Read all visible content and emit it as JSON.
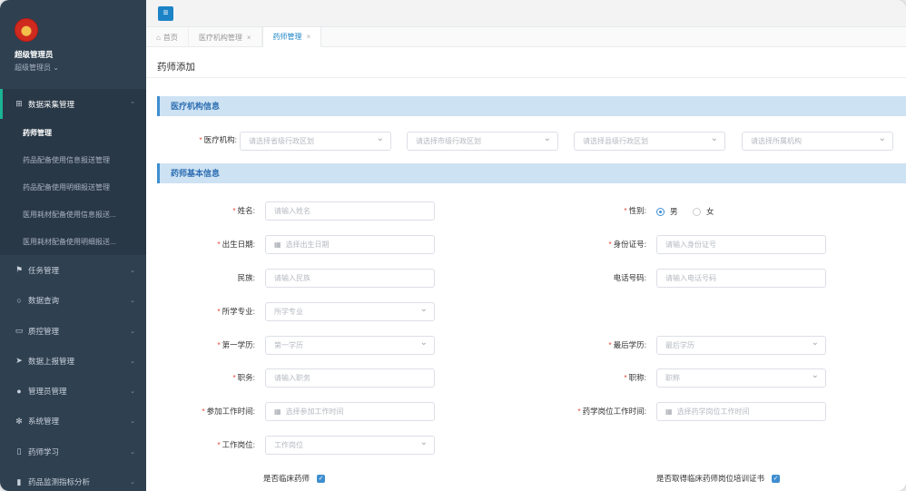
{
  "sidebar": {
    "user_name": "超级管理员",
    "user_role": "超级管理员 ⌄",
    "open_menu": {
      "label": "数据采集管理",
      "icon": "plus-square-icon"
    },
    "sub_items": [
      {
        "label": "药师管理",
        "active": true
      },
      {
        "label": "药品配备使用信息报送管理"
      },
      {
        "label": "药品配备使用明细报送管理"
      },
      {
        "label": "医用耗材配备使用信息报送..."
      },
      {
        "label": "医用耗材配备使用明细报送..."
      }
    ],
    "menu": [
      {
        "label": "任务管理",
        "icon": "flag-icon"
      },
      {
        "label": "数据查询",
        "icon": "search-icon"
      },
      {
        "label": "质控管理",
        "icon": "folder-icon"
      },
      {
        "label": "数据上报管理",
        "icon": "send-icon"
      },
      {
        "label": "管理员管理",
        "icon": "user-icon"
      },
      {
        "label": "系统管理",
        "icon": "gear-icon"
      },
      {
        "label": "药师学习",
        "icon": "book-icon"
      },
      {
        "label": "药品监测指标分析",
        "icon": "bar-chart-icon"
      }
    ]
  },
  "tabs": [
    {
      "label": "首页",
      "home": true
    },
    {
      "label": "医疗机构管理",
      "close": "×"
    },
    {
      "label": "药师管理",
      "close": "×",
      "active": true
    }
  ],
  "page_title": "药师添加",
  "section_org": "医疗机构信息",
  "section_basic": "药师基本信息",
  "org": {
    "label": "医疗机构:",
    "selects": [
      "请选择省级行政区划",
      "请选择市级行政区划",
      "请选择县级行政区划",
      "请选择所属机构"
    ]
  },
  "form": {
    "name_label": "姓名:",
    "name_placeholder": "请输入姓名",
    "gender_label": "性别:",
    "gender_male": "男",
    "gender_female": "女",
    "birth_label": "出生日期:",
    "birth_placeholder": "选择出生日期",
    "id_label": "身份证号:",
    "id_placeholder": "请输入身份证号",
    "ethnic_label": "民族:",
    "ethnic_placeholder": "请输入民族",
    "phone_label": "电话号码:",
    "phone_placeholder": "请输入电话号码",
    "major_label": "所学专业:",
    "major_placeholder": "所学专业",
    "first_edu_label": "第一学历:",
    "first_edu_placeholder": "第一学历",
    "last_edu_label": "最后学历:",
    "last_edu_placeholder": "最后学历",
    "duty_label": "职务:",
    "duty_placeholder": "请输入职务",
    "title_label": "职称:",
    "title_placeholder": "职称",
    "work_start_label": "参加工作时间:",
    "work_start_placeholder": "选择参加工作时间",
    "pharm_start_label": "药学岗位工作时间:",
    "pharm_start_placeholder": "选择药学岗位工作时间",
    "post_label": "工作岗位:",
    "post_placeholder": "工作岗位",
    "clinical_label": "是否临床药师",
    "cert_label": "是否取得临床药师岗位培训证书"
  },
  "colors": {
    "accent": "#3f8ed0",
    "sidebar": "#2f4050",
    "required": "#e74c3c"
  }
}
